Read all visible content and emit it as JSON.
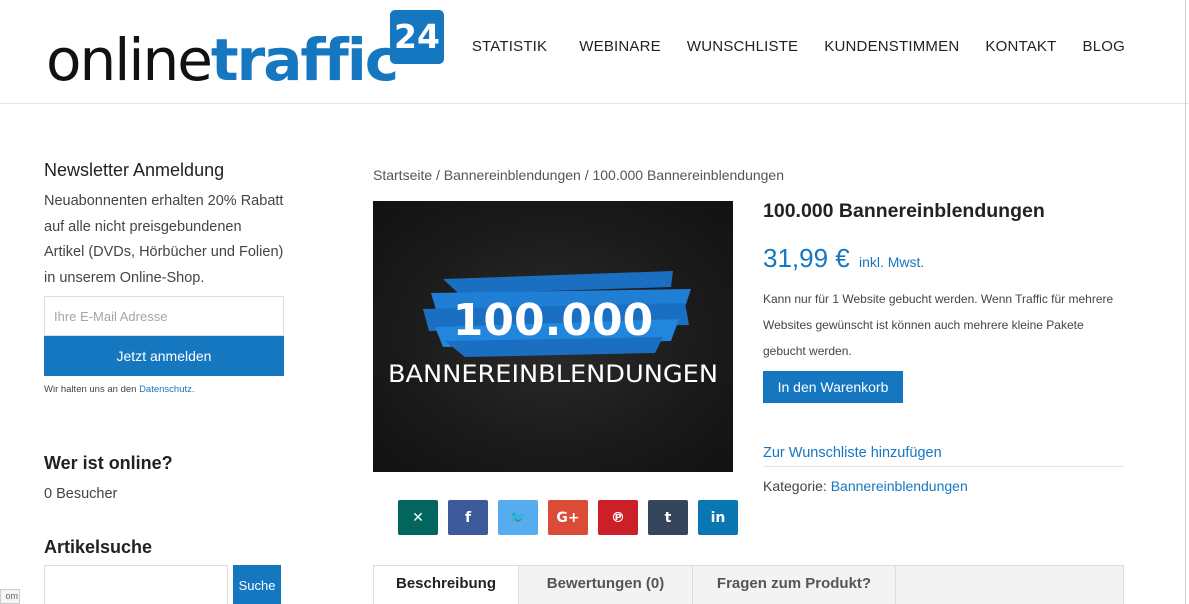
{
  "brand": {
    "logo_part1": "online",
    "logo_part2": "traffic",
    "logo_badge": "24",
    "primary_color": "#1577c0"
  },
  "nav": {
    "items": [
      "STATISTIK",
      "WEBINARE",
      "WUNSCHLISTE",
      "KUNDENSTIMMEN",
      "KONTAKT",
      "BLOG"
    ]
  },
  "sidebar": {
    "newsletter": {
      "title": "Newsletter Anmeldung",
      "text": "Neuabonnenten erhalten 20% Rabatt auf alle nicht preisgebundenen Artikel (DVDs, Hörbücher und Folien) in unserem Online-Shop.",
      "email_placeholder": "Ihre E-Mail Adresse",
      "button_label": "Jetzt anmelden",
      "privacy_prefix": "Wir halten uns an den",
      "privacy_link": "Datenschutz."
    },
    "online": {
      "title": "Wer ist online?",
      "count": "0 Besucher"
    },
    "search": {
      "title": "Artikelsuche",
      "button_label": "Suche"
    },
    "corner_tag": "om"
  },
  "breadcrumb": "Startseite / Bannereinblendungen / 100.000 Bannereinblendungen",
  "product": {
    "image_number": "100.000",
    "image_word": "BANNEREINBLENDUNGEN",
    "title": "100.000 Bannereinblendungen",
    "price": "31,99 €",
    "price_suffix": "inkl. Mwst.",
    "description": "Kann nur für 1 Website gebucht werden. Wenn Traffic für mehrere Websites gewünscht ist können auch mehrere kleine Pakete gebucht werden.",
    "cart_button": "In den Warenkorb",
    "wishlist_link": "Zur Wunschliste hinzufügen",
    "category_label": "Kategorie:",
    "category_value": "Bannereinblendungen"
  },
  "share": [
    {
      "icon": "xing-icon",
      "glyph": "✕",
      "color": "#02665f"
    },
    {
      "icon": "facebook-icon",
      "glyph": "f",
      "color": "#3c5a99"
    },
    {
      "icon": "twitter-icon",
      "glyph": "🐦",
      "color": "#55acee"
    },
    {
      "icon": "google-plus-icon",
      "glyph": "G+",
      "color": "#dc4a38"
    },
    {
      "icon": "pinterest-icon",
      "glyph": "℗",
      "color": "#cb2027"
    },
    {
      "icon": "tumblr-icon",
      "glyph": "t",
      "color": "#35465c"
    },
    {
      "icon": "linkedin-icon",
      "glyph": "in",
      "color": "#0a77b5"
    }
  ],
  "tabs": [
    "Beschreibung",
    "Bewertungen (0)",
    "Fragen zum Produkt?"
  ]
}
